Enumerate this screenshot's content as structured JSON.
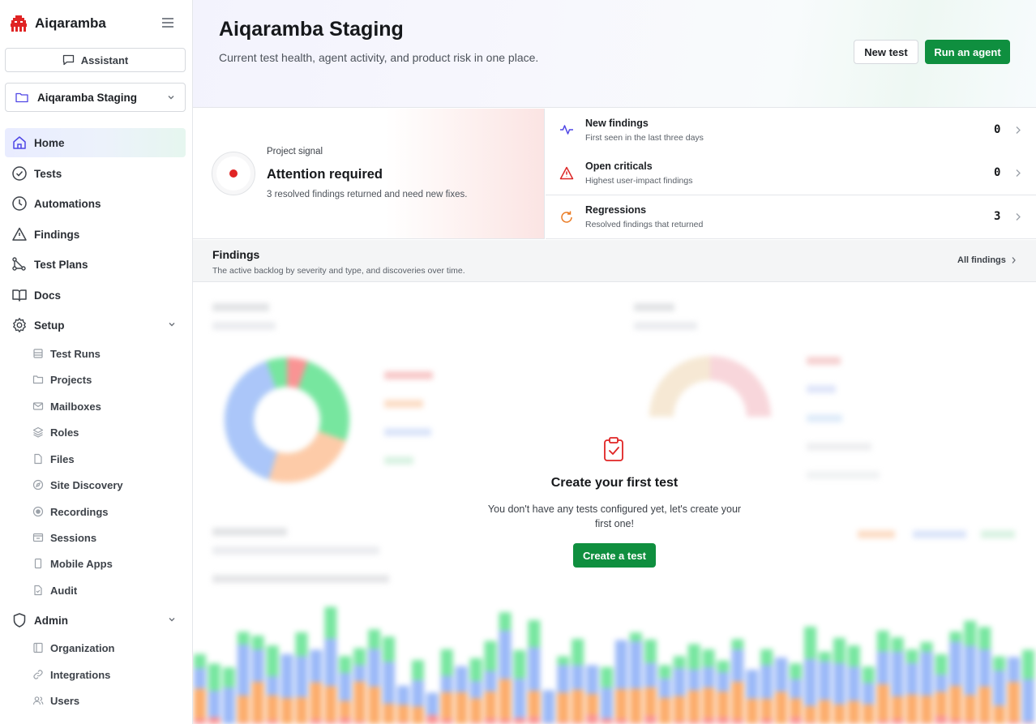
{
  "app": {
    "name": "Aiqaramba"
  },
  "sidebar": {
    "assistant_label": "Assistant",
    "project": "Aiqaramba Staging",
    "nav": [
      {
        "label": "Home",
        "icon": "home-icon",
        "active": true
      },
      {
        "label": "Tests",
        "icon": "check-circle-icon"
      },
      {
        "label": "Automations",
        "icon": "clock-icon"
      },
      {
        "label": "Findings",
        "icon": "warning-triangle-icon"
      },
      {
        "label": "Test Plans",
        "icon": "nodes-icon"
      },
      {
        "label": "Docs",
        "icon": "book-icon"
      },
      {
        "label": "Setup",
        "icon": "gear-icon",
        "expanded": true
      }
    ],
    "setup_items": [
      {
        "label": "Test Runs",
        "icon": "runs-icon"
      },
      {
        "label": "Projects",
        "icon": "folder-icon"
      },
      {
        "label": "Mailboxes",
        "icon": "mail-icon"
      },
      {
        "label": "Roles",
        "icon": "layers-icon"
      },
      {
        "label": "Files",
        "icon": "file-icon"
      },
      {
        "label": "Site Discovery",
        "icon": "compass-icon"
      },
      {
        "label": "Recordings",
        "icon": "record-icon"
      },
      {
        "label": "Sessions",
        "icon": "sessions-icon"
      },
      {
        "label": "Mobile Apps",
        "icon": "phone-icon"
      },
      {
        "label": "Audit",
        "icon": "audit-icon"
      }
    ],
    "admin": {
      "label": "Admin",
      "icon": "shield-icon",
      "expanded": true
    },
    "admin_items": [
      {
        "label": "Organization",
        "icon": "building-icon"
      },
      {
        "label": "Integrations",
        "icon": "link-icon"
      },
      {
        "label": "Users",
        "icon": "users-icon"
      }
    ]
  },
  "header": {
    "title": "Aiqaramba Staging",
    "subtitle": "Current test health, agent activity, and product risk in one place.",
    "new_test_label": "New test",
    "run_agent_label": "Run an agent"
  },
  "signal": {
    "label": "Project signal",
    "title": "Attention required",
    "description": "3 resolved findings returned and need new fixes.",
    "status_color": "#e02424"
  },
  "metrics": [
    {
      "title": "New findings",
      "subtitle": "First seen in the last three days",
      "value": "0",
      "icon": "activity-icon",
      "color": "#4f46e5"
    },
    {
      "title": "Open criticals",
      "subtitle": "Highest user-impact findings",
      "value": "0",
      "icon": "alert-triangle-icon",
      "color": "#dc2626"
    },
    {
      "title": "Regressions",
      "subtitle": "Resolved findings that returned",
      "value": "3",
      "icon": "refresh-icon",
      "color": "#ea7a22"
    }
  ],
  "findings": {
    "title": "Findings",
    "subtitle": "The active backlog by severity and type, and discoveries over time.",
    "all_link": "All findings"
  },
  "empty_state": {
    "title": "Create your first test",
    "description": "You don't have any tests configured yet, let's create your first one!",
    "button": "Create a test"
  },
  "colors": {
    "brand_green": "#0f8f3f",
    "brand_red": "#e02424"
  }
}
